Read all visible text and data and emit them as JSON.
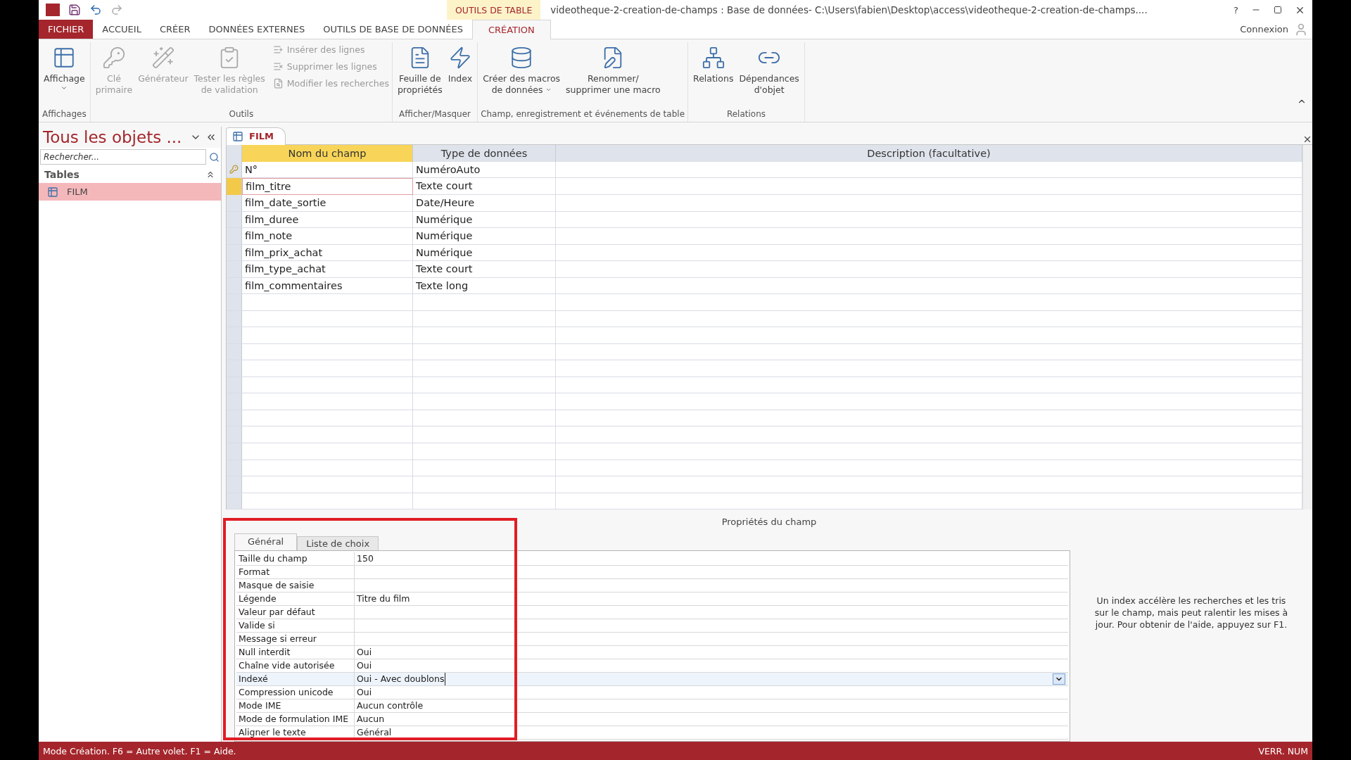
{
  "title_bar": {
    "context_label": "OUTILS DE TABLE",
    "title": "videotheque-2-creation-de-champs : Base de données- C:\\Users\\fabien\\Desktop\\access\\videotheque-2-creation-de-champs....",
    "help": "?"
  },
  "menu_tabs": [
    {
      "label": "FICHIER",
      "kind": "file",
      "selected": false
    },
    {
      "label": "ACCUEIL",
      "kind": "tab",
      "selected": false
    },
    {
      "label": "CRÉER",
      "kind": "tab",
      "selected": false
    },
    {
      "label": "DONNÉES EXTERNES",
      "kind": "tab",
      "selected": false
    },
    {
      "label": "OUTILS DE BASE DE DONNÉES",
      "kind": "tab",
      "selected": false
    },
    {
      "label": "CRÉATION",
      "kind": "tab",
      "selected": true
    }
  ],
  "account": "Connexion",
  "ribbon": [
    {
      "name": "Affichages",
      "buttons": [
        {
          "kind": "large",
          "lines": [
            "Affichage"
          ],
          "dropdown": true,
          "disabled": false
        }
      ]
    },
    {
      "name": "Outils",
      "buttons": [
        {
          "kind": "large",
          "lines": [
            "Clé",
            "primaire"
          ],
          "dropdown": false,
          "disabled": true
        },
        {
          "kind": "large",
          "lines": [
            "Générateur"
          ],
          "dropdown": false,
          "disabled": true
        },
        {
          "kind": "large",
          "lines": [
            "Tester les règles",
            "de validation"
          ],
          "dropdown": false,
          "disabled": true
        },
        {
          "kind": "small",
          "lines": [
            "Insérer des lignes"
          ],
          "disabled": true
        },
        {
          "kind": "small",
          "lines": [
            "Supprimer les lignes"
          ],
          "disabled": true
        },
        {
          "kind": "small",
          "lines": [
            "Modifier les recherches"
          ],
          "disabled": true
        }
      ]
    },
    {
      "name": "Afficher/Masquer",
      "buttons": [
        {
          "kind": "large",
          "lines": [
            "Feuille de",
            "propriétés"
          ],
          "dropdown": false,
          "disabled": false
        },
        {
          "kind": "large",
          "lines": [
            "Index"
          ],
          "dropdown": false,
          "disabled": false
        }
      ]
    },
    {
      "name": "Champ, enregistrement et événements de table",
      "buttons": [
        {
          "kind": "large",
          "lines": [
            "Créer des macros",
            "de données"
          ],
          "dropdown": true,
          "disabled": false
        },
        {
          "kind": "large",
          "lines": [
            "Renommer/",
            "supprimer une macro"
          ],
          "dropdown": false,
          "disabled": false
        }
      ]
    },
    {
      "name": "Relations",
      "buttons": [
        {
          "kind": "large",
          "lines": [
            "Relations"
          ],
          "dropdown": false,
          "disabled": false
        },
        {
          "kind": "large",
          "lines": [
            "Dépendances",
            "d'objet"
          ],
          "dropdown": false,
          "disabled": false
        }
      ]
    }
  ],
  "nav_pane": {
    "title": "Tous les objets ...",
    "search": {
      "placeholder": "Rechercher..."
    },
    "group": "Tables",
    "items": [
      {
        "label": "FILM",
        "selected": true
      }
    ]
  },
  "document_tab": {
    "label": "FILM"
  },
  "table": {
    "columns": [
      "Nom du champ",
      "Type de données",
      "Description (facultative)"
    ],
    "rows": [
      {
        "name": "N°",
        "type": "NuméroAuto",
        "primary_key": true,
        "selected": false
      },
      {
        "name": "film_titre",
        "type": "Texte court",
        "primary_key": false,
        "selected": true
      },
      {
        "name": "film_date_sortie",
        "type": "Date/Heure",
        "primary_key": false,
        "selected": false
      },
      {
        "name": "film_duree",
        "type": "Numérique",
        "primary_key": false,
        "selected": false
      },
      {
        "name": "film_note",
        "type": "Numérique",
        "primary_key": false,
        "selected": false
      },
      {
        "name": "film_prix_achat",
        "type": "Numérique",
        "primary_key": false,
        "selected": false
      },
      {
        "name": "film_type_achat",
        "type": "Texte court",
        "primary_key": false,
        "selected": false
      },
      {
        "name": "film_commentaires",
        "type": "Texte long",
        "primary_key": false,
        "selected": false
      }
    ]
  },
  "field_properties": {
    "title": "Propriétés du champ",
    "tabs": [
      {
        "label": "Général",
        "selected": true
      },
      {
        "label": "Liste de choix",
        "selected": false
      }
    ],
    "rows": [
      {
        "label": "Taille du champ",
        "value": "150",
        "focused": false
      },
      {
        "label": "Format",
        "focused": false
      },
      {
        "label": "Masque de saisie",
        "focused": false
      },
      {
        "label": "Légende",
        "value": "Titre du film",
        "focused": false
      },
      {
        "label": "Valeur par défaut",
        "focused": false
      },
      {
        "label": "Valide si",
        "focused": false
      },
      {
        "label": "Message si erreur",
        "focused": false
      },
      {
        "label": "Null interdit",
        "value": "Oui",
        "focused": false
      },
      {
        "label": "Chaîne vide autorisée",
        "value": "Oui",
        "focused": false
      },
      {
        "label": "Indexé",
        "value": "Oui - Avec doublons",
        "focused": true
      },
      {
        "label": "Compression unicode",
        "value": "Oui",
        "focused": false
      },
      {
        "label": "Mode IME",
        "value": "Aucun contrôle",
        "focused": false
      },
      {
        "label": "Mode de formulation IME",
        "value": "Aucun",
        "focused": false
      },
      {
        "label": "Aligner le texte",
        "value": "Général",
        "focused": false
      }
    ],
    "help": "Un index accélère les recherches et les tris sur le champ, mais peut ralentir les mises à jour. Pour obtenir de l'aide, appuyez sur F1."
  },
  "status_bar": {
    "message": "Mode Création. F6 = Autre volet. F1 = Aide.",
    "indicator": "VERR. NUM"
  }
}
